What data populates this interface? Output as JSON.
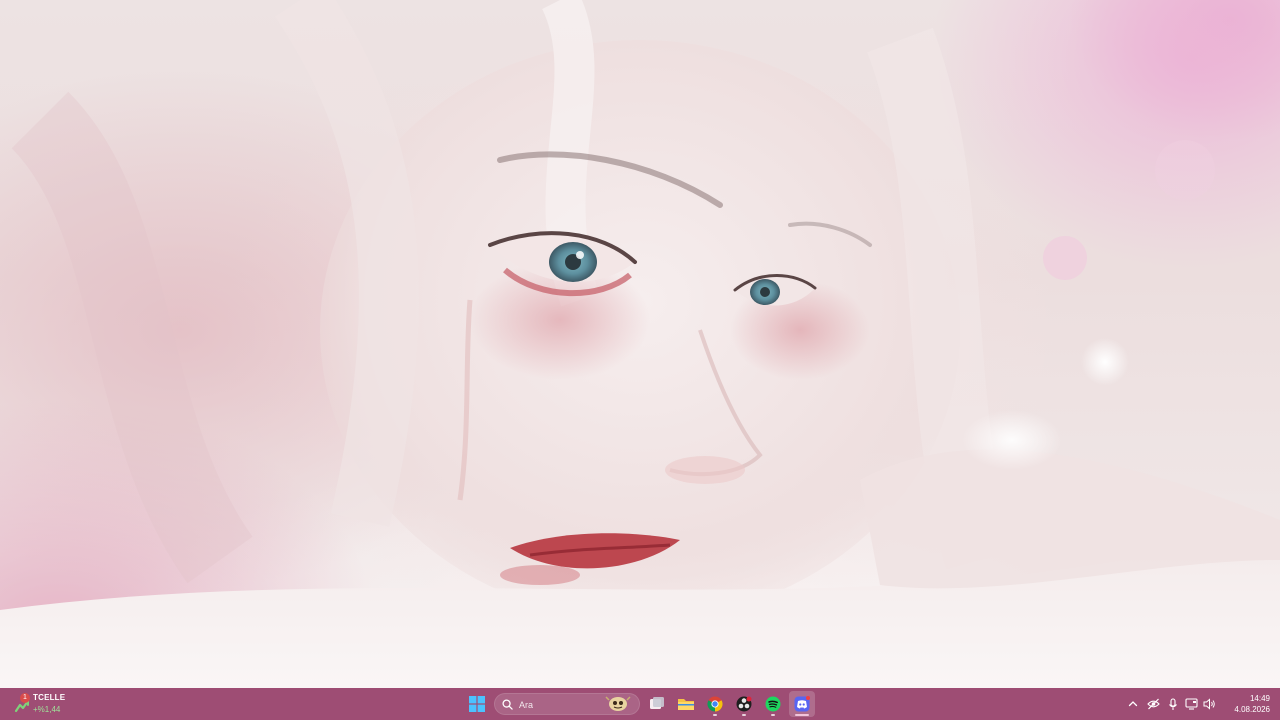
{
  "widget": {
    "badge": "1",
    "ticker": "TCELLE",
    "change": "+%1,44",
    "icon": "stock-widget-icon"
  },
  "search": {
    "placeholder": "Ara",
    "icon": "search-icon"
  },
  "taskbar_apps": [
    {
      "name": "start",
      "icon": "windows-logo-icon"
    },
    {
      "name": "task-view",
      "icon": "task-view-icon"
    },
    {
      "name": "file-explorer",
      "icon": "folder-icon"
    },
    {
      "name": "chrome",
      "icon": "chrome-icon",
      "running": true
    },
    {
      "name": "obs",
      "icon": "obs-icon",
      "running": true
    },
    {
      "name": "spotify",
      "icon": "spotify-icon",
      "running": true
    },
    {
      "name": "discord",
      "icon": "discord-icon",
      "running": true,
      "active": true
    }
  ],
  "tray": {
    "icons": [
      "chevron-up-icon",
      "eye-off-icon",
      "microphone-icon",
      "display-icon",
      "speaker-icon"
    ]
  },
  "clock": {
    "time": "14:49",
    "date": "4.08.2026"
  },
  "colors": {
    "taskbar": "#9e4d74",
    "accent_green": "#9fe39a"
  }
}
